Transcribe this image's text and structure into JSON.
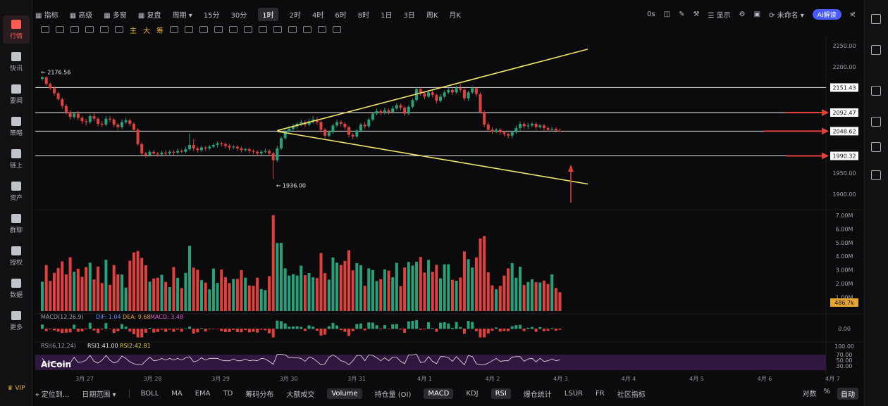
{
  "sidebar": {
    "items": [
      {
        "label": "行情",
        "icon": "candlestick-icon",
        "active": true
      },
      {
        "label": "快讯",
        "icon": "news-icon"
      },
      {
        "label": "要闻",
        "icon": "article-icon"
      },
      {
        "label": "策略",
        "icon": "robot-icon"
      },
      {
        "label": "链上",
        "icon": "chain-icon"
      },
      {
        "label": "资产",
        "icon": "wallet-icon"
      },
      {
        "label": "群聊",
        "icon": "chat-icon"
      },
      {
        "label": "授权",
        "icon": "authorize-icon"
      },
      {
        "label": "数据",
        "icon": "data-icon"
      },
      {
        "label": "更多",
        "icon": "more-icon"
      }
    ],
    "vip": "VIP"
  },
  "topbar": {
    "items": [
      "指标",
      "高级",
      "多窗",
      "复盘",
      "周期",
      "15分",
      "30分",
      "1时",
      "2时",
      "4时",
      "6时",
      "8时",
      "1日",
      "3日",
      "周K",
      "月K"
    ],
    "active": "1时",
    "latency": "0s",
    "display": "显示",
    "layout_name": "未命名",
    "ai_button": "AI解读"
  },
  "drawtools": {
    "labels": [
      "主",
      "大",
      "筹"
    ]
  },
  "price_axis": {
    "ticks": [
      "2250.00",
      "2200.00",
      "2151.43",
      "2092.47",
      "2048.62",
      "1990.32",
      "1950.00",
      "1900.00"
    ],
    "highlighted": [
      "2151.43",
      "2092.47",
      "2048.62",
      "1990.32"
    ]
  },
  "annotations": {
    "high_label": "← 2176.56",
    "low_label": "← 1936.00"
  },
  "volume_axis": {
    "ticks": [
      "7.00M",
      "6.00M",
      "5.00M",
      "4.00M",
      "3.00M",
      "2.00M",
      "1.00M"
    ],
    "current": "486.7k"
  },
  "macd": {
    "label": "MACD(12,26,9)",
    "dif": "DIF: 1.04",
    "dea": "DEA: 9.68",
    "macd": "MACD: 3.48",
    "zero": "0.00"
  },
  "rsi": {
    "label": "RSI(6,12,24)",
    "rsi1": "RSI1:41.00",
    "rsi2": "RSI2:42.81",
    "ticks": [
      "100.00",
      "70.00",
      "50.00",
      "30.00"
    ]
  },
  "watermark": "AiCoin",
  "time_axis": [
    "3月 27",
    "3月 28",
    "3月 29",
    "3月 30",
    "3月 31",
    "4月 1",
    "4月 2",
    "4月 3",
    "4月 4",
    "4月 5",
    "4月 6",
    "4月 7"
  ],
  "bottombar": {
    "left": [
      "定位到...",
      "日期范围"
    ],
    "indicators": [
      "BOLL",
      "MA",
      "EMA",
      "TD",
      "筹码分布",
      "大额成交",
      "Volume",
      "持仓量 (OI)",
      "MACD",
      "KDJ",
      "RSI",
      "爆仓统计",
      "LSUR",
      "FR",
      "社区指标"
    ],
    "active": [
      "Volume",
      "MACD",
      "RSI"
    ],
    "right": [
      "对数",
      "%",
      "自动"
    ]
  },
  "colors": {
    "up": "#26a17b",
    "down": "#e0413c",
    "trend": "#f0e46a",
    "arrow": "#e0413c"
  },
  "chart_data": {
    "type": "candlestick",
    "candles": [
      [
        2172,
        2176,
        2168,
        2178
      ],
      [
        2176,
        2160,
        2156,
        2178
      ],
      [
        2160,
        2150,
        2146,
        2164
      ],
      [
        2150,
        2138,
        2132,
        2154
      ],
      [
        2138,
        2124,
        2120,
        2142
      ],
      [
        2124,
        2108,
        2102,
        2128
      ],
      [
        2108,
        2094,
        2088,
        2112
      ],
      [
        2094,
        2082,
        2076,
        2098
      ],
      [
        2082,
        2090,
        2078,
        2094
      ],
      [
        2090,
        2080,
        2074,
        2096
      ],
      [
        2080,
        2072,
        2066,
        2084
      ],
      [
        2072,
        2070,
        2062,
        2078
      ],
      [
        2070,
        2084,
        2066,
        2088
      ],
      [
        2084,
        2078,
        2072,
        2092
      ],
      [
        2078,
        2066,
        2060,
        2082
      ],
      [
        2066,
        2064,
        2058,
        2072
      ],
      [
        2064,
        2078,
        2060,
        2084
      ],
      [
        2078,
        2076,
        2070,
        2084
      ],
      [
        2076,
        2064,
        2058,
        2080
      ],
      [
        2064,
        2058,
        2052,
        2068
      ],
      [
        2058,
        2070,
        2054,
        2076
      ],
      [
        2070,
        2074,
        2066,
        2080
      ],
      [
        2074,
        2066,
        2060,
        2078
      ],
      [
        2066,
        2052,
        2046,
        2070
      ],
      [
        2052,
        2018,
        2014,
        2056
      ],
      [
        2018,
        1996,
        1992,
        2022
      ],
      [
        1996,
        1992,
        1986,
        2000
      ],
      [
        1992,
        2000,
        1988,
        2004
      ],
      [
        2000,
        1996,
        1990,
        2004
      ],
      [
        1996,
        1994,
        1988,
        2000
      ],
      [
        1994,
        1998,
        1990,
        2002
      ],
      [
        1998,
        1996,
        1990,
        2004
      ],
      [
        1996,
        2000,
        1992,
        2004
      ],
      [
        2000,
        1998,
        1992,
        2004
      ],
      [
        1998,
        2002,
        1994,
        2008
      ],
      [
        2002,
        2000,
        1996,
        2006
      ],
      [
        2000,
        2006,
        1996,
        2012
      ],
      [
        2006,
        2016,
        2002,
        2044
      ],
      [
        2016,
        2008,
        2002,
        2030
      ],
      [
        2008,
        2004,
        1998,
        2012
      ],
      [
        2004,
        2010,
        2000,
        2014
      ],
      [
        2010,
        2008,
        2002,
        2014
      ],
      [
        2008,
        2012,
        2004,
        2016
      ],
      [
        2012,
        2016,
        2008,
        2020
      ],
      [
        2016,
        2020,
        2010,
        2024
      ],
      [
        2020,
        2018,
        2012,
        2024
      ],
      [
        2018,
        2014,
        2008,
        2022
      ],
      [
        2014,
        2010,
        2004,
        2018
      ],
      [
        2010,
        2012,
        2006,
        2016
      ],
      [
        2012,
        2008,
        2002,
        2016
      ],
      [
        2008,
        2004,
        1998,
        2012
      ],
      [
        2004,
        2006,
        2000,
        2010
      ],
      [
        2006,
        2002,
        1996,
        2010
      ],
      [
        2002,
        2000,
        1994,
        2006
      ],
      [
        2000,
        1996,
        1990,
        2004
      ],
      [
        1996,
        2000,
        1992,
        2004
      ],
      [
        2000,
        2002,
        1996,
        2008
      ],
      [
        2002,
        1996,
        1990,
        2006
      ],
      [
        1996,
        1980,
        1936,
        2000
      ],
      [
        1980,
        2008,
        1976,
        2014
      ],
      [
        2008,
        2032,
        2004,
        2036
      ],
      [
        2032,
        2048,
        2028,
        2052
      ],
      [
        2048,
        2054,
        2044,
        2060
      ],
      [
        2054,
        2060,
        2050,
        2066
      ],
      [
        2060,
        2066,
        2054,
        2070
      ],
      [
        2066,
        2070,
        2060,
        2076
      ],
      [
        2070,
        2064,
        2058,
        2074
      ],
      [
        2064,
        2072,
        2060,
        2078
      ],
      [
        2072,
        2076,
        2066,
        2084
      ],
      [
        2076,
        2070,
        2064,
        2082
      ],
      [
        2070,
        2052,
        2046,
        2074
      ],
      [
        2052,
        2038,
        2032,
        2056
      ],
      [
        2038,
        2046,
        2034,
        2050
      ],
      [
        2046,
        2062,
        2042,
        2066
      ],
      [
        2062,
        2070,
        2058,
        2076
      ],
      [
        2070,
        2066,
        2060,
        2074
      ],
      [
        2066,
        2058,
        2052,
        2070
      ],
      [
        2058,
        2040,
        2034,
        2062
      ],
      [
        2040,
        2036,
        2030,
        2044
      ],
      [
        2036,
        2050,
        2032,
        2054
      ],
      [
        2050,
        2064,
        2046,
        2068
      ],
      [
        2064,
        2060,
        2054,
        2070
      ],
      [
        2060,
        2076,
        2056,
        2080
      ],
      [
        2076,
        2090,
        2072,
        2094
      ],
      [
        2090,
        2096,
        2086,
        2102
      ],
      [
        2096,
        2092,
        2086,
        2100
      ],
      [
        2092,
        2098,
        2088,
        2104
      ],
      [
        2098,
        2094,
        2088,
        2102
      ],
      [
        2094,
        2102,
        2090,
        2108
      ],
      [
        2102,
        2110,
        2098,
        2114
      ],
      [
        2110,
        2104,
        2098,
        2114
      ],
      [
        2104,
        2090,
        2084,
        2108
      ],
      [
        2090,
        2106,
        2086,
        2110
      ],
      [
        2106,
        2122,
        2102,
        2126
      ],
      [
        2122,
        2148,
        2118,
        2152
      ],
      [
        2148,
        2138,
        2132,
        2152
      ],
      [
        2138,
        2130,
        2124,
        2142
      ],
      [
        2130,
        2140,
        2126,
        2146
      ],
      [
        2140,
        2134,
        2128,
        2144
      ],
      [
        2134,
        2120,
        2114,
        2138
      ],
      [
        2120,
        2130,
        2116,
        2136
      ],
      [
        2130,
        2140,
        2126,
        2144
      ],
      [
        2140,
        2146,
        2136,
        2152
      ],
      [
        2146,
        2140,
        2134,
        2150
      ],
      [
        2140,
        2150,
        2136,
        2156
      ],
      [
        2150,
        2146,
        2140,
        2160
      ],
      [
        2146,
        2126,
        2120,
        2150
      ],
      [
        2126,
        2140,
        2120,
        2144
      ],
      [
        2140,
        2150,
        2136,
        2154
      ],
      [
        2150,
        2136,
        2130,
        2152
      ],
      [
        2136,
        2094,
        2090,
        2140
      ],
      [
        2094,
        2064,
        2058,
        2098
      ],
      [
        2064,
        2052,
        2046,
        2070
      ],
      [
        2052,
        2048,
        2042,
        2058
      ],
      [
        2048,
        2052,
        2044,
        2056
      ],
      [
        2052,
        2046,
        2040,
        2056
      ],
      [
        2046,
        2042,
        2036,
        2050
      ],
      [
        2042,
        2038,
        2032,
        2046
      ],
      [
        2038,
        2046,
        2032,
        2050
      ],
      [
        2046,
        2056,
        2042,
        2062
      ],
      [
        2056,
        2066,
        2050,
        2072
      ],
      [
        2066,
        2060,
        2054,
        2070
      ],
      [
        2060,
        2062,
        2054,
        2068
      ],
      [
        2062,
        2066,
        2058,
        2070
      ],
      [
        2066,
        2058,
        2052,
        2070
      ],
      [
        2058,
        2062,
        2054,
        2066
      ],
      [
        2062,
        2056,
        2050,
        2066
      ],
      [
        2056,
        2052,
        2048,
        2060
      ],
      [
        2052,
        2054,
        2048,
        2058
      ],
      [
        2054,
        2050,
        2046,
        2058
      ],
      [
        2050,
        2049,
        2046,
        2054
      ]
    ],
    "trendlines": [
      {
        "from": [
          59,
          2050
        ],
        "to": [
          137,
          2242
        ],
        "color": "#f0e46a"
      },
      {
        "from": [
          59,
          2048
        ],
        "to": [
          137,
          1924
        ],
        "color": "#f0e46a"
      }
    ],
    "hlines": [
      2151.43,
      2092.47,
      2048.62,
      1990.32
    ],
    "ylim": [
      1880,
      2265
    ]
  }
}
